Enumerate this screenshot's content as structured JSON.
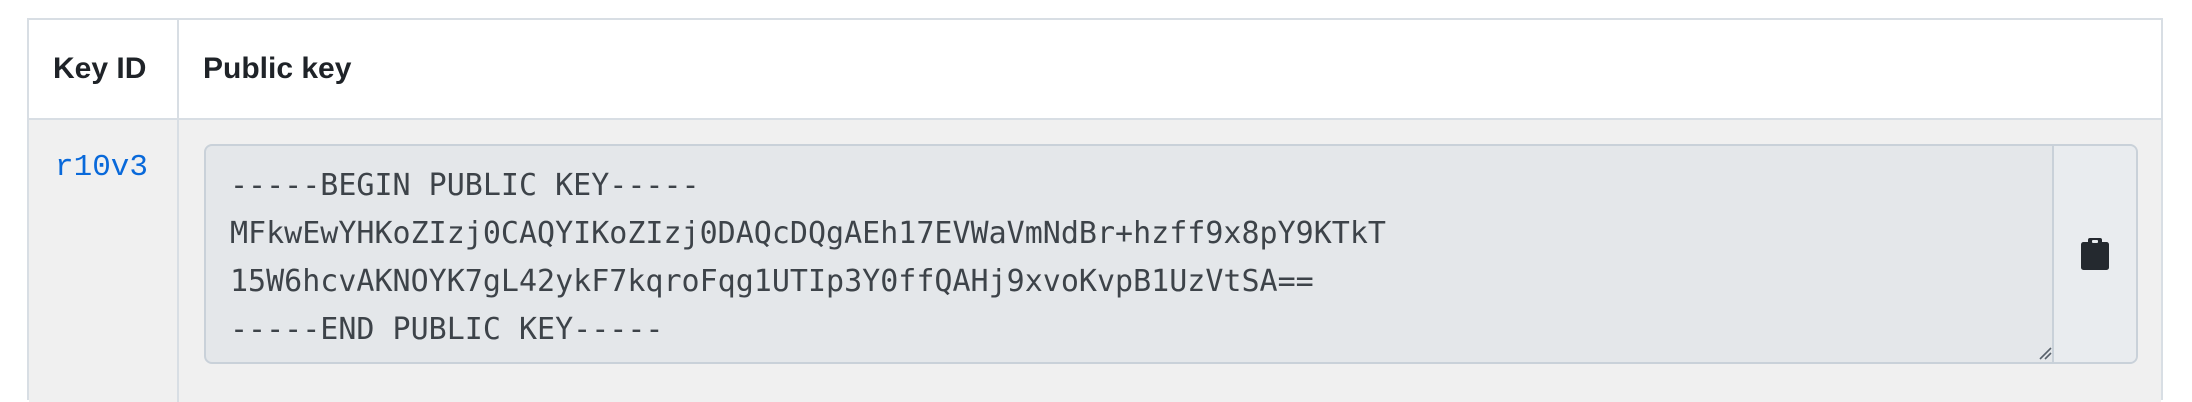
{
  "table": {
    "headers": {
      "key_id": "Key ID",
      "public_key": "Public key"
    },
    "rows": [
      {
        "key_id": "r10v3",
        "public_key": "-----BEGIN PUBLIC KEY-----\nMFkwEwYHKoZIzj0CAQYIKoZIzj0DAQcDQgAEh17EVWaVmNdBr+hzff9x8pY9KTkT\n15W6hcvAKNOYK7gL42ykF7kqroFqg1UTIp3Y0ffQAHj9xvoKvpB1UzVtSA==\n-----END PUBLIC KEY-----"
      }
    ]
  },
  "icons": {
    "copy": "clipboard-icon",
    "resize": "resize-grip-icon"
  },
  "colors": {
    "link": "#0969da",
    "border": "#d8dee4",
    "row_background": "#f0f0f0",
    "key_box_background": "#e4e7ea"
  }
}
